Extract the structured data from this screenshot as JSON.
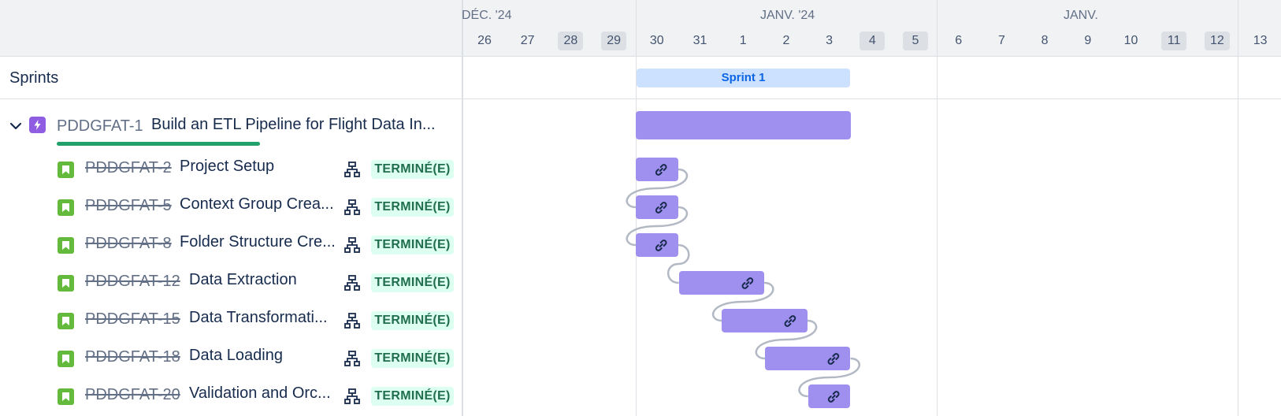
{
  "sprints_label": "Sprints",
  "epic": {
    "key": "PDDGFAT-1",
    "summary": "Build an ETL Pipeline for Flight Data In...",
    "icon": "epic-lightning-icon",
    "progress": 1.0
  },
  "children": [
    {
      "key": "PDDGFAT-2",
      "summary": "Project Setup",
      "status": "TERMINÉ(E)"
    },
    {
      "key": "PDDGFAT-5",
      "summary": "Context Group Crea...",
      "status": "TERMINÉ(E)"
    },
    {
      "key": "PDDGFAT-8",
      "summary": "Folder Structure Cre...",
      "status": "TERMINÉ(E)"
    },
    {
      "key": "PDDGFAT-12",
      "summary": "Data Extraction",
      "status": "TERMINÉ(E)"
    },
    {
      "key": "PDDGFAT-15",
      "summary": "Data Transformati...",
      "status": "TERMINÉ(E)"
    },
    {
      "key": "PDDGFAT-18",
      "summary": "Data Loading",
      "status": "TERMINÉ(E)"
    },
    {
      "key": "PDDGFAT-20",
      "summary": "Validation and Orc...",
      "status": "TERMINÉ(E)"
    }
  ],
  "timeline": {
    "months": [
      "DÉC. '24",
      "JANV. '24",
      "JANV."
    ],
    "days": [
      "26",
      "27",
      "28",
      "29",
      "30",
      "31",
      "1",
      "2",
      "3",
      "4",
      "5",
      "6",
      "7",
      "8",
      "9",
      "10",
      "11",
      "12",
      "13"
    ],
    "weekend_days": [
      "28",
      "29",
      "4",
      "5",
      "11",
      "12"
    ],
    "sprint": {
      "label": "Sprint 1",
      "start_day": "30",
      "end_day": "4"
    }
  },
  "colors": {
    "bar": "#9f8fef",
    "epic_icon": "#8f5de2",
    "story_icon": "#63ba3c",
    "status_bg": "#dcfff1",
    "status_text": "#216e4e",
    "progress": "#22a06b",
    "sprint_bg": "#cce0ff",
    "sprint_text": "#0c66e4"
  }
}
